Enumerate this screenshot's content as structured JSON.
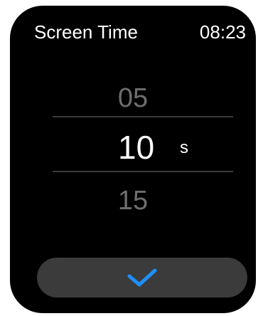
{
  "header": {
    "title": "Screen Time",
    "time": "08:23"
  },
  "picker": {
    "previous": "05",
    "current": "10",
    "next": "15",
    "unit": "s"
  },
  "confirm": {
    "icon": "checkmark-icon",
    "icon_color": "#1e90ff"
  },
  "colors": {
    "background": "#000000",
    "button": "#3b3b3b",
    "dim_text": "#6e6e6e",
    "accent": "#1e90ff"
  }
}
